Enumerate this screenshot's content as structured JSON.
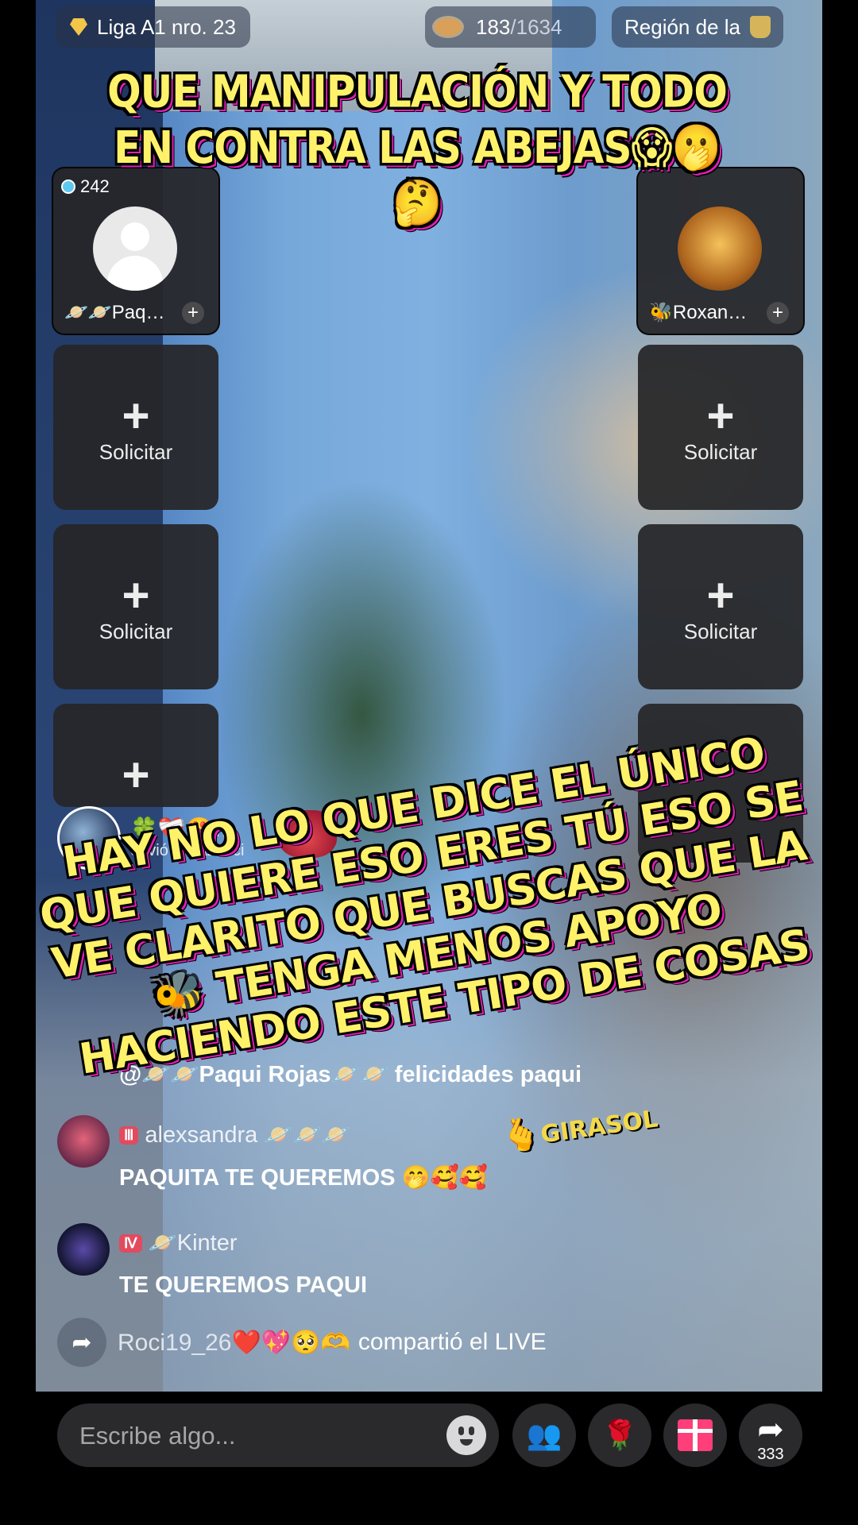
{
  "top_bar": {
    "liga": "Liga A1 nro. 23",
    "viewers_current": "183",
    "viewers_total": "/1634",
    "region": "Región de la"
  },
  "captions": {
    "top": "QUE MANIPULACIÓN Y TODO EN CONTRA LAS ABEJAS😱🫢🤔",
    "middle": "HAY NO LO QUE DICE EL ÚNICO QUE QUIERE ESO ERES TÚ ESO SE VE CLARITO QUE BUSCAS QUE LA 🐝 TENGA MENOS APOYO HACIENDO ESTE TIPO DE COSAS"
  },
  "guest_slots": {
    "left_host": {
      "score": "242",
      "name": "🪐🪐Paq…"
    },
    "right_host": {
      "name": "🐝Roxan…"
    },
    "request_label": "Solicitar",
    "plus": "+"
  },
  "gift_banner": {
    "emojis": "🍀❤️‍🩹😍…",
    "sender": "envió Corazonci"
  },
  "chat": [
    {
      "mention": "@🪐🪐Paqui Rojas🪐🪐 felicidades paqui"
    },
    {
      "level": "Ⅲ",
      "user": "alexsandra 🪐🪐🪐",
      "message": "PAQUITA TE QUEREMOS 🤭🥰🥰"
    },
    {
      "level": "Ⅳ",
      "user": "🪐Kinter",
      "message": "TE QUEREMOS PAQUI"
    }
  ],
  "share_event": {
    "user": "Roci19_26❤️💖🥺🫶",
    "text": "compartió el LIVE"
  },
  "bottom_bar": {
    "input_placeholder": "Escribe algo...",
    "rose": "🌹",
    "share_count": "333"
  },
  "sticker": "GIRASOL"
}
